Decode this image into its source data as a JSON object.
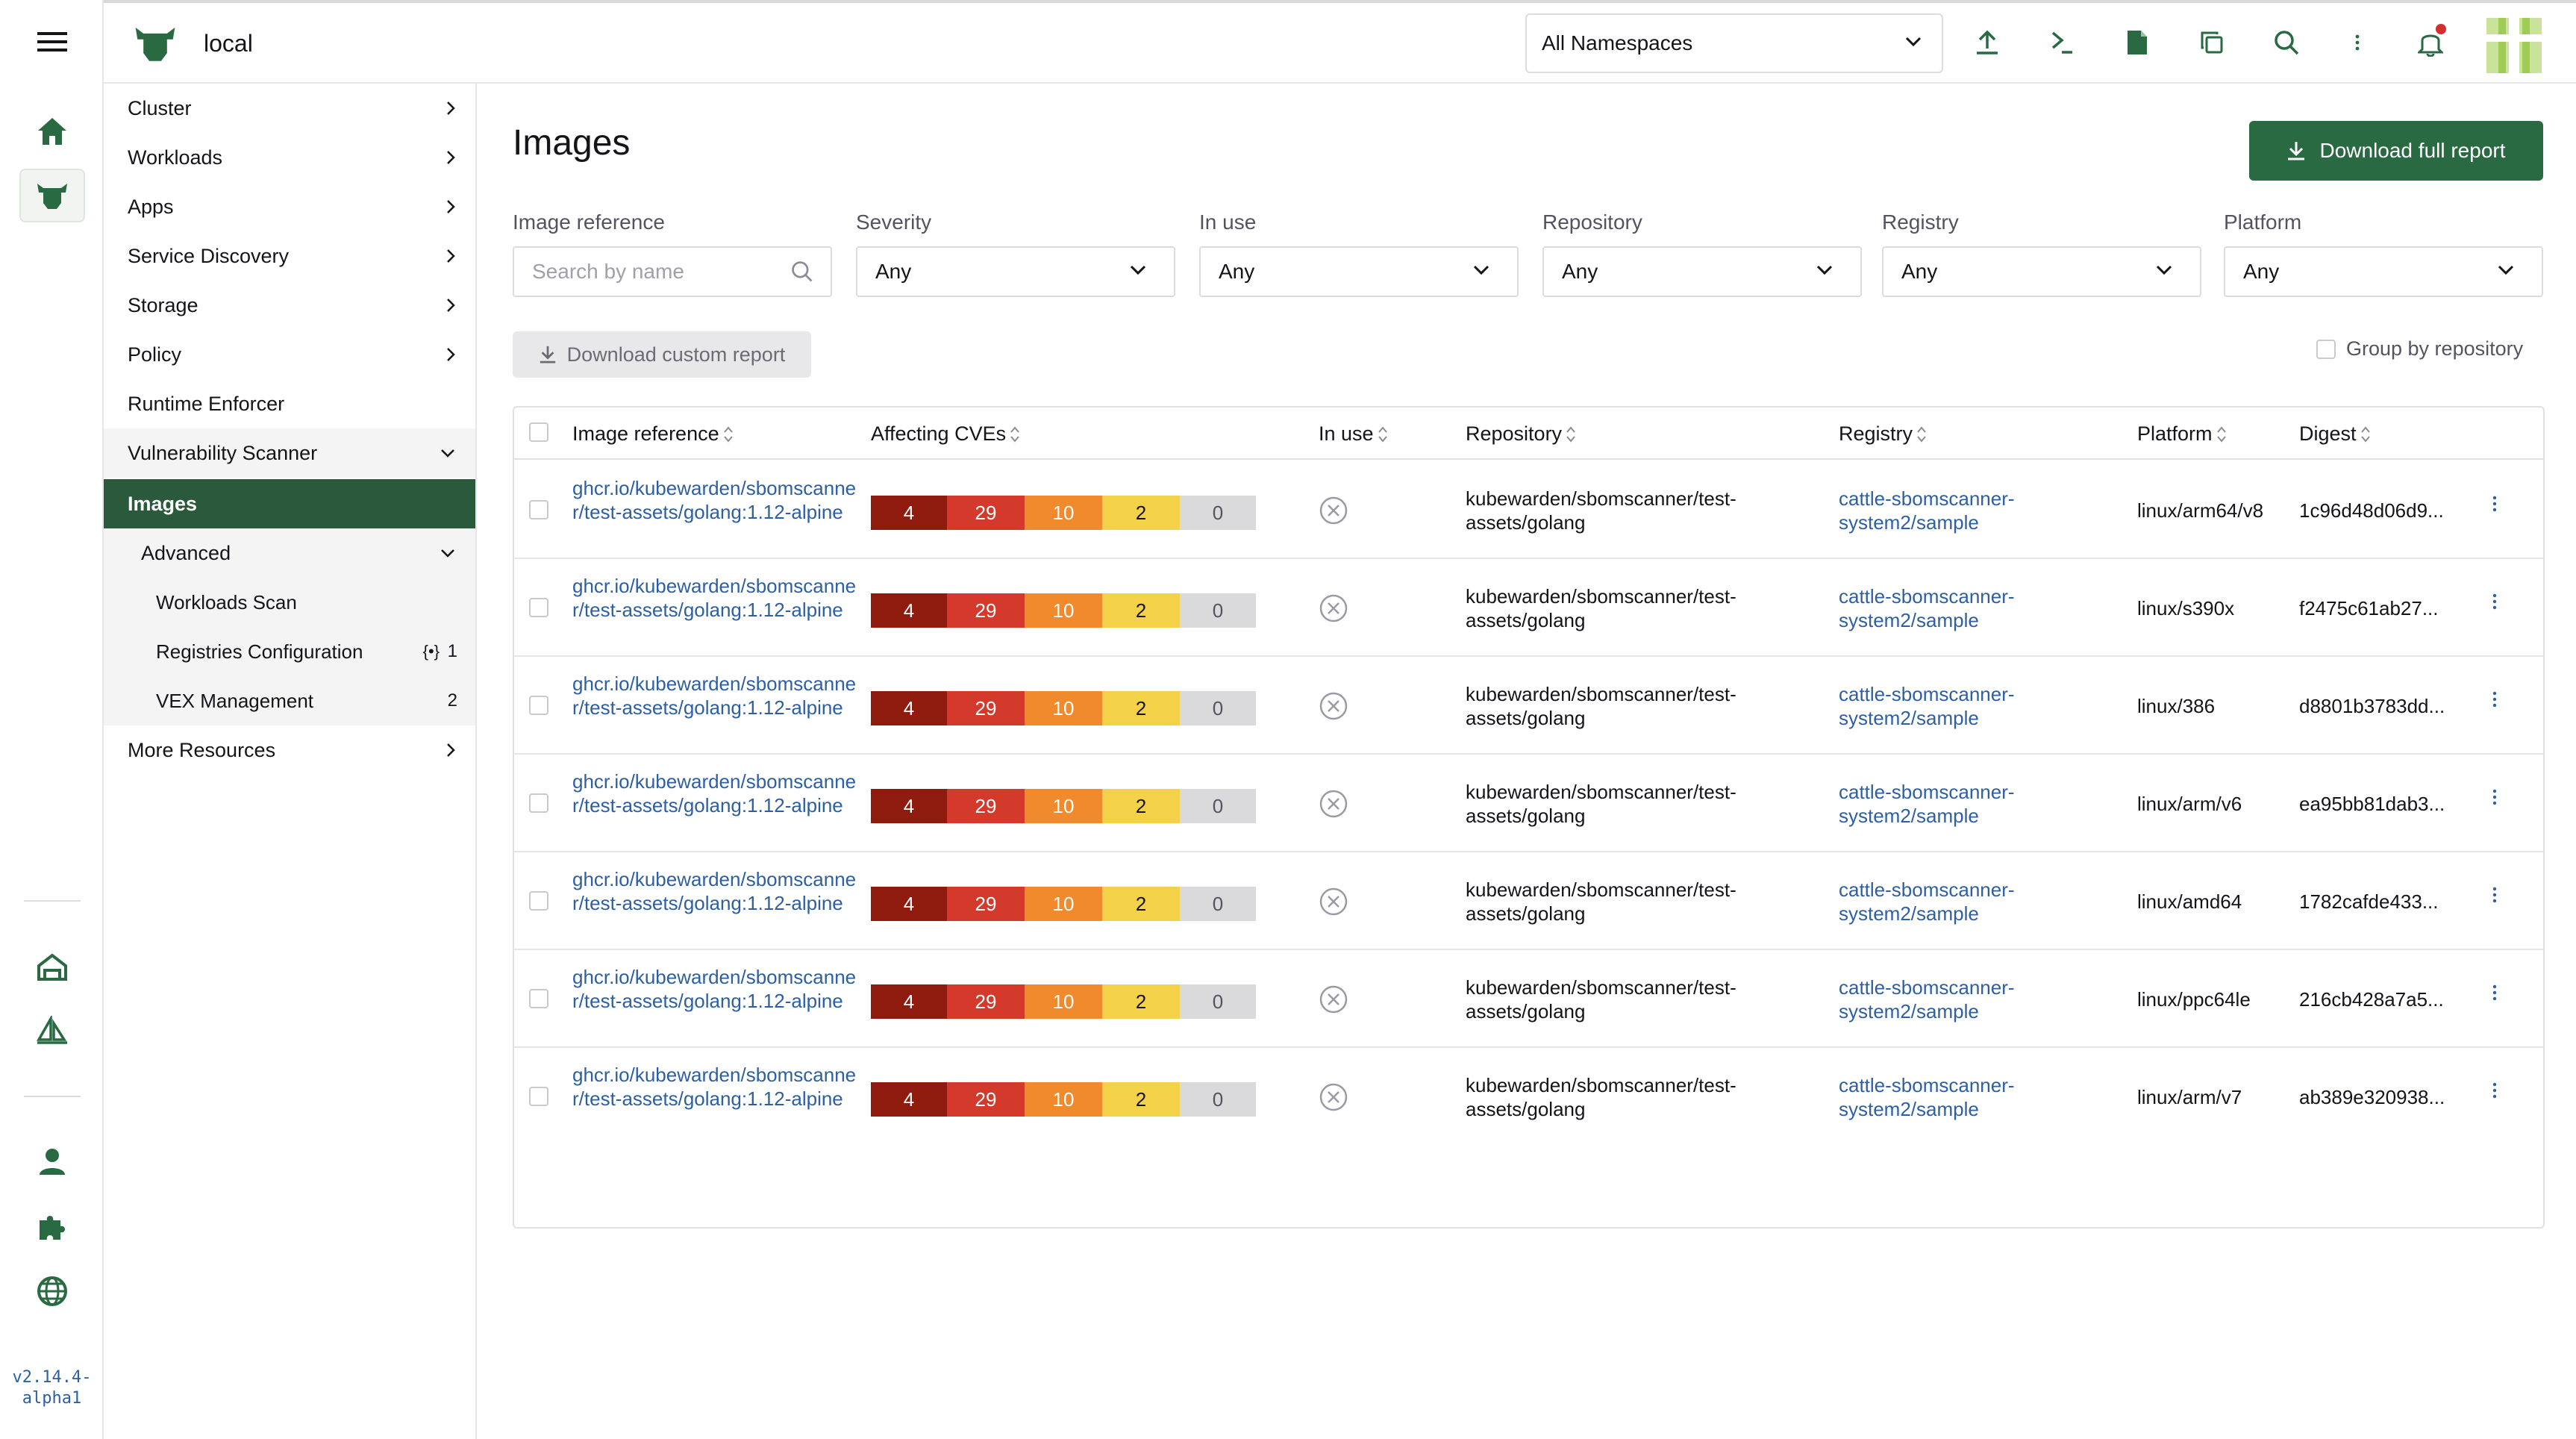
{
  "rail": {
    "version": "v2.14.4-alpha1"
  },
  "header": {
    "cluster_name": "local",
    "namespace_selected": "All Namespaces"
  },
  "sidenav": {
    "items": [
      {
        "label": "Cluster"
      },
      {
        "label": "Workloads"
      },
      {
        "label": "Apps"
      },
      {
        "label": "Service Discovery"
      },
      {
        "label": "Storage"
      },
      {
        "label": "Policy"
      },
      {
        "label": "Runtime Enforcer"
      },
      {
        "label": "Vulnerability Scanner"
      },
      {
        "label": "Images"
      },
      {
        "label": "Advanced"
      },
      {
        "label": "Workloads Scan"
      },
      {
        "label": "Registries Configuration",
        "count": "1"
      },
      {
        "label": "VEX Management",
        "count": "2"
      },
      {
        "label": "More Resources"
      }
    ]
  },
  "main": {
    "title": "Images",
    "download_full": "Download full report",
    "download_custom": "Download custom report",
    "group_by": "Group by repository",
    "filters": {
      "image_reference": {
        "label": "Image reference",
        "placeholder": "Search by name"
      },
      "severity": {
        "label": "Severity",
        "value": "Any"
      },
      "in_use": {
        "label": "In use",
        "value": "Any"
      },
      "repository": {
        "label": "Repository",
        "value": "Any"
      },
      "registry": {
        "label": "Registry",
        "value": "Any"
      },
      "platform": {
        "label": "Platform",
        "value": "Any"
      }
    },
    "columns": {
      "image_reference": "Image reference",
      "affecting_cves": "Affecting CVEs",
      "in_use": "In use",
      "repository": "Repository",
      "registry": "Registry",
      "platform": "Platform",
      "digest": "Digest"
    },
    "rows": [
      {
        "image": "ghcr.io/kubewarden/sbomscanner/test-assets/golang:1.12-alpine",
        "cves": [
          "4",
          "29",
          "10",
          "2",
          "0"
        ],
        "repository": "kubewarden/sbomscanner/test-assets/golang",
        "registry": "cattle-sbomscanner-system2/sample",
        "platform": "linux/arm64/v8",
        "digest": "1c96d48d06d9..."
      },
      {
        "image": "ghcr.io/kubewarden/sbomscanner/test-assets/golang:1.12-alpine",
        "cves": [
          "4",
          "29",
          "10",
          "2",
          "0"
        ],
        "repository": "kubewarden/sbomscanner/test-assets/golang",
        "registry": "cattle-sbomscanner-system2/sample",
        "platform": "linux/s390x",
        "digest": "f2475c61ab27..."
      },
      {
        "image": "ghcr.io/kubewarden/sbomscanner/test-assets/golang:1.12-alpine",
        "cves": [
          "4",
          "29",
          "10",
          "2",
          "0"
        ],
        "repository": "kubewarden/sbomscanner/test-assets/golang",
        "registry": "cattle-sbomscanner-system2/sample",
        "platform": "linux/386",
        "digest": "d8801b3783dd..."
      },
      {
        "image": "ghcr.io/kubewarden/sbomscanner/test-assets/golang:1.12-alpine",
        "cves": [
          "4",
          "29",
          "10",
          "2",
          "0"
        ],
        "repository": "kubewarden/sbomscanner/test-assets/golang",
        "registry": "cattle-sbomscanner-system2/sample",
        "platform": "linux/arm/v6",
        "digest": "ea95bb81dab3..."
      },
      {
        "image": "ghcr.io/kubewarden/sbomscanner/test-assets/golang:1.12-alpine",
        "cves": [
          "4",
          "29",
          "10",
          "2",
          "0"
        ],
        "repository": "kubewarden/sbomscanner/test-assets/golang",
        "registry": "cattle-sbomscanner-system2/sample",
        "platform": "linux/amd64",
        "digest": "1782cafde433..."
      },
      {
        "image": "ghcr.io/kubewarden/sbomscanner/test-assets/golang:1.12-alpine",
        "cves": [
          "4",
          "29",
          "10",
          "2",
          "0"
        ],
        "repository": "kubewarden/sbomscanner/test-assets/golang",
        "registry": "cattle-sbomscanner-system2/sample",
        "platform": "linux/ppc64le",
        "digest": "216cb428a7a5..."
      },
      {
        "image": "ghcr.io/kubewarden/sbomscanner/test-assets/golang:1.12-alpine",
        "cves": [
          "4",
          "29",
          "10",
          "2",
          "0"
        ],
        "repository": "kubewarden/sbomscanner/test-assets/golang",
        "registry": "cattle-sbomscanner-system2/sample",
        "platform": "linux/arm/v7",
        "digest": "ab389e320938..."
      }
    ]
  },
  "colors": {
    "brand_green": "#2a6a43",
    "nav_active": "#2a5a3b",
    "link": "#2d5fa5",
    "critical": "#8f1b0e",
    "high": "#d33a2c",
    "medium": "#f08a2c",
    "low": "#f3d24a",
    "unknown": "#dadadd"
  }
}
